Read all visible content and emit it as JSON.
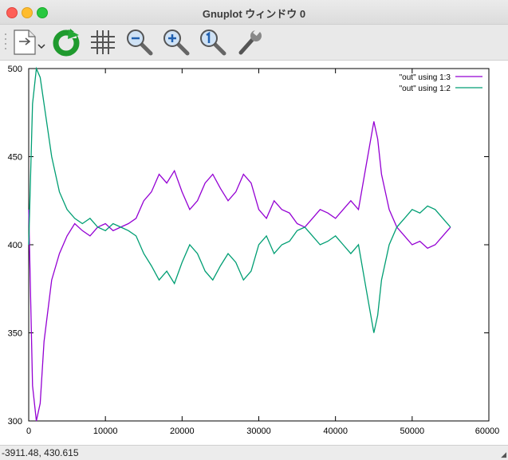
{
  "window": {
    "title": "Gnuplot ウィンドウ 0"
  },
  "toolbar": {
    "buttons": [
      {
        "name": "export-button",
        "icon": "document-export-icon"
      },
      {
        "name": "replot-button",
        "icon": "refresh-icon"
      },
      {
        "name": "grid-button",
        "icon": "grid-icon"
      },
      {
        "name": "zoom-out-button",
        "icon": "zoom-out-icon"
      },
      {
        "name": "zoom-in-button",
        "icon": "zoom-in-icon"
      },
      {
        "name": "zoom-reset-button",
        "icon": "zoom-reset-icon"
      },
      {
        "name": "settings-button",
        "icon": "wrench-icon"
      }
    ]
  },
  "status": {
    "coords": "-3911.48,  430.615"
  },
  "chart_data": {
    "type": "line",
    "title": "",
    "xlabel": "",
    "ylabel": "",
    "xlim": [
      0,
      60000
    ],
    "ylim": [
      300,
      500
    ],
    "xticks": [
      "0",
      "10000",
      "20000",
      "30000",
      "40000",
      "50000",
      "60000"
    ],
    "yticks": [
      "300",
      "350",
      "400",
      "450",
      "500"
    ],
    "grid": false,
    "legend": "top-right",
    "series": [
      {
        "name": "\"out\" using 1:3",
        "color": "#9400d3",
        "x": [
          0,
          500,
          1000,
          1500,
          2000,
          3000,
          4000,
          5000,
          6000,
          7000,
          8000,
          9000,
          10000,
          11000,
          12000,
          13000,
          14000,
          15000,
          16000,
          17000,
          18000,
          19000,
          20000,
          21000,
          22000,
          23000,
          24000,
          25000,
          26000,
          27000,
          28000,
          29000,
          30000,
          31000,
          32000,
          33000,
          34000,
          35000,
          36000,
          37000,
          38000,
          39000,
          40000,
          41000,
          42000,
          43000,
          44000,
          45000,
          45500,
          46000,
          47000,
          48000,
          49000,
          50000,
          51000,
          52000,
          53000,
          54000,
          55000
        ],
        "y": [
          420,
          320,
          300,
          310,
          345,
          380,
          395,
          405,
          412,
          408,
          405,
          410,
          412,
          408,
          410,
          412,
          415,
          425,
          430,
          440,
          435,
          442,
          430,
          420,
          425,
          435,
          440,
          432,
          425,
          430,
          440,
          435,
          420,
          415,
          425,
          420,
          418,
          412,
          410,
          415,
          420,
          418,
          415,
          420,
          425,
          420,
          445,
          470,
          460,
          440,
          420,
          410,
          405,
          400,
          402,
          398,
          400,
          405,
          410
        ]
      },
      {
        "name": "\"out\" using 1:2",
        "color": "#009e73",
        "x": [
          0,
          500,
          1000,
          1500,
          2000,
          3000,
          4000,
          5000,
          6000,
          7000,
          8000,
          9000,
          10000,
          11000,
          12000,
          13000,
          14000,
          15000,
          16000,
          17000,
          18000,
          19000,
          20000,
          21000,
          22000,
          23000,
          24000,
          25000,
          26000,
          27000,
          28000,
          29000,
          30000,
          31000,
          32000,
          33000,
          34000,
          35000,
          36000,
          37000,
          38000,
          39000,
          40000,
          41000,
          42000,
          43000,
          44000,
          45000,
          45500,
          46000,
          47000,
          48000,
          49000,
          50000,
          51000,
          52000,
          53000,
          54000,
          55000
        ],
        "y": [
          400,
          480,
          500,
          495,
          480,
          450,
          430,
          420,
          415,
          412,
          415,
          410,
          408,
          412,
          410,
          408,
          405,
          395,
          388,
          380,
          385,
          378,
          390,
          400,
          395,
          385,
          380,
          388,
          395,
          390,
          380,
          385,
          400,
          405,
          395,
          400,
          402,
          408,
          410,
          405,
          400,
          402,
          405,
          400,
          395,
          400,
          375,
          350,
          360,
          380,
          400,
          410,
          415,
          420,
          418,
          422,
          420,
          415,
          410
        ]
      }
    ]
  }
}
